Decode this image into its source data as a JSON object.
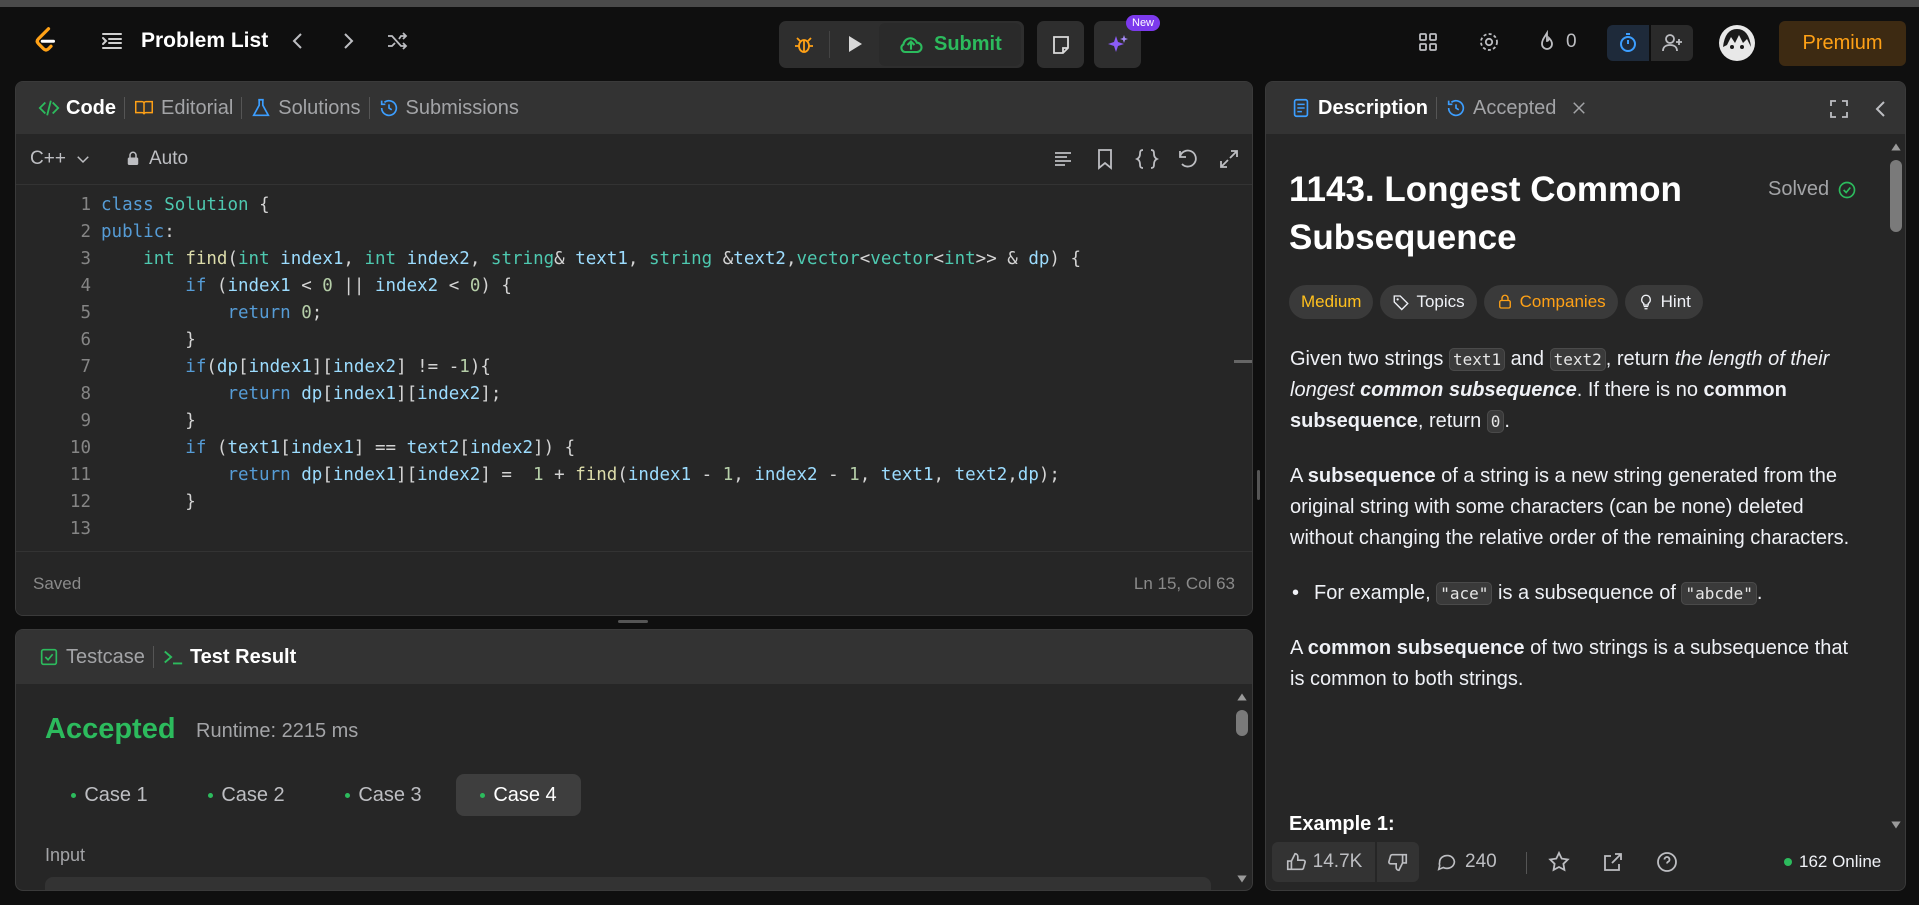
{
  "topbar": {
    "problem_list": "Problem List",
    "submit": "Submit",
    "new_badge": "New",
    "streak": "0",
    "premium": "Premium"
  },
  "code_panel": {
    "tabs": [
      "Code",
      "Editorial",
      "Solutions",
      "Submissions"
    ],
    "language": "C++",
    "auto": "Auto",
    "status": "Saved",
    "cursor": "Ln 15, Col 63",
    "lines": [
      "class Solution {",
      "public:",
      "    int find(int index1, int index2, string& text1, string &text2,vector<vector<int>> & dp) {",
      "        if (index1 < 0 || index2 < 0) {",
      "            return 0;",
      "        }",
      "        if(dp[index1][index2] != -1){",
      "            return dp[index1][index2];",
      "        }",
      "        if (text1[index1] == text2[index2]) {",
      "            return dp[index1][index2] =  1 + find(index1 - 1, index2 - 1, text1, text2,dp);",
      "        }",
      ""
    ]
  },
  "test_panel": {
    "tabs": [
      "Testcase",
      "Test Result"
    ],
    "result": "Accepted",
    "runtime": "Runtime: 2215 ms",
    "cases": [
      "Case 1",
      "Case 2",
      "Case 3",
      "Case 4"
    ],
    "input_label": "Input"
  },
  "desc_panel": {
    "tabs": [
      "Description",
      "Accepted"
    ],
    "title": "1143. Longest Common Subsequence",
    "solved": "Solved",
    "badges": [
      "Medium",
      "Topics",
      "Companies",
      "Hint"
    ],
    "p1": {
      "a": "Given two strings ",
      "c1": "text1",
      "b": " and ",
      "c2": "text2",
      "c": ", return ",
      "em1": "the length of their longest ",
      "strong_em": "common subsequence",
      "d": ". If there is no ",
      "strong1": "common subsequence",
      "e": ", return ",
      "c3": "0",
      "f": "."
    },
    "p2": {
      "a": "A ",
      "strong": "subsequence",
      "b": " of a string is a new string generated from the original string with some characters (can be none) deleted without changing the relative order of the remaining characters."
    },
    "bullet": {
      "a": "For example, ",
      "c1": "\"ace\"",
      "b": " is a subsequence of ",
      "c2": "\"abcde\"",
      "c": "."
    },
    "p3": {
      "a": "A ",
      "strong": "common subsequence",
      "b": " of two strings is a subsequence that is common to both strings."
    },
    "example": "Example 1:",
    "likes": "14.7K",
    "comments": "240",
    "online": "162 Online"
  },
  "colors": {
    "accent_green": "#2cbb5d",
    "medium": "#ffc01e",
    "companies": "#ffa116",
    "blue": "#3c9eff",
    "premium": "#ffa116"
  }
}
